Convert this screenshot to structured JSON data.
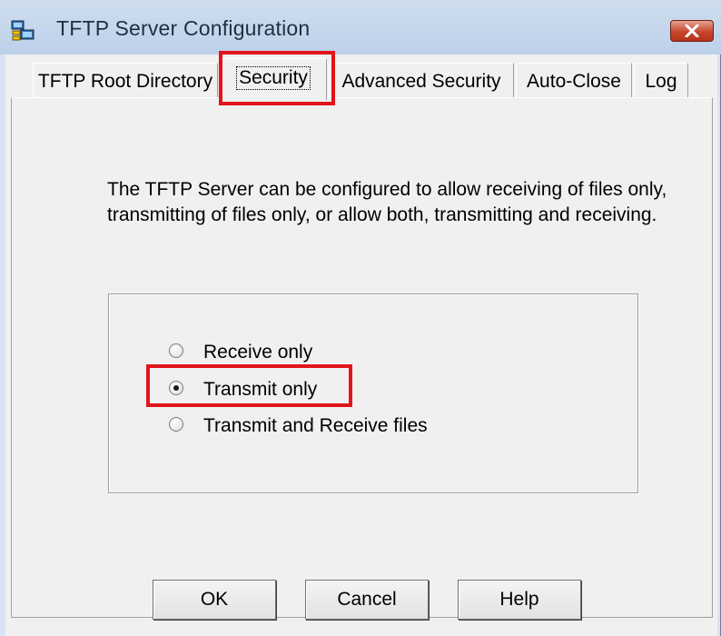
{
  "window": {
    "title": "TFTP Server Configuration",
    "icon": "network-computers-icon",
    "close_icon": "close-x-icon"
  },
  "tabs": [
    {
      "label": "TFTP Root Directory",
      "selected": false
    },
    {
      "label": "Security",
      "selected": true
    },
    {
      "label": "Advanced Security",
      "selected": false
    },
    {
      "label": "Auto-Close",
      "selected": false
    },
    {
      "label": "Log",
      "selected": false
    }
  ],
  "security": {
    "description": "The TFTP Server can be configured to allow receiving of files only, transmitting of files only, or allow both, transmitting and receiving.",
    "options": [
      {
        "label": "Receive only",
        "checked": false
      },
      {
        "label": "Transmit only",
        "checked": true
      },
      {
        "label": "Transmit and Receive files",
        "checked": false
      }
    ]
  },
  "buttons": {
    "ok": "OK",
    "cancel": "Cancel",
    "help": "Help"
  },
  "colors": {
    "highlight": "#e2141b",
    "close_button": "#c5472d"
  }
}
